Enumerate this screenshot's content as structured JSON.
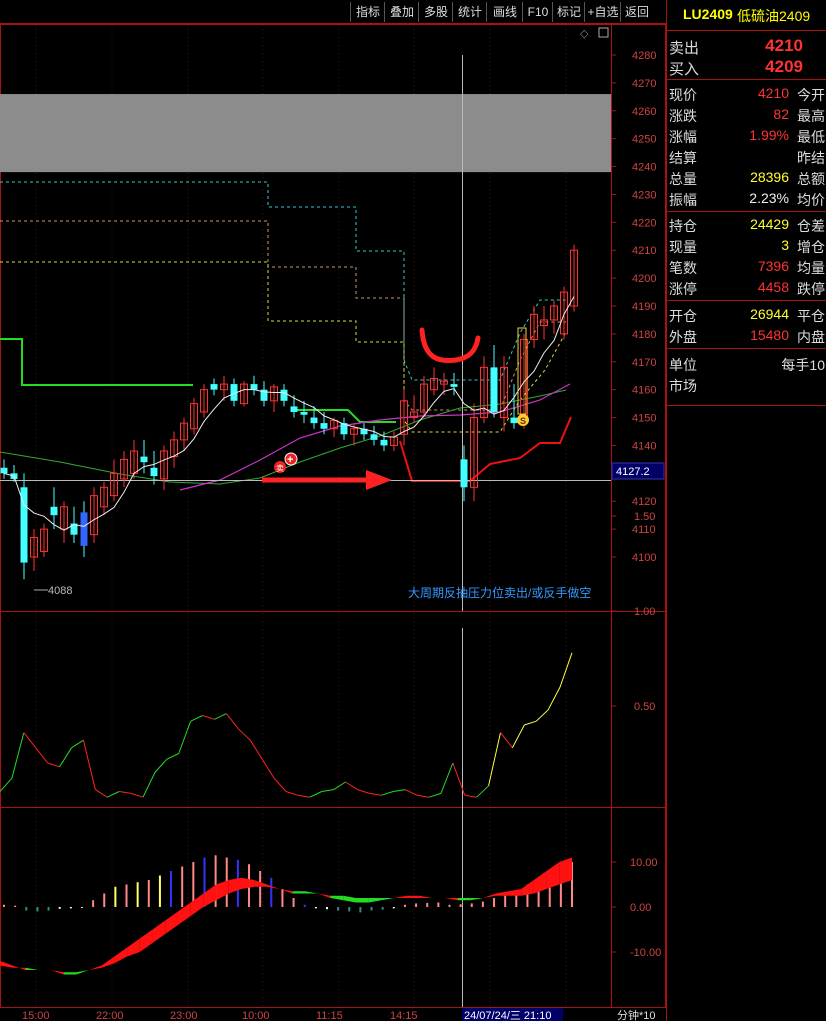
{
  "toolbar": {
    "buttons": [
      "指标",
      "叠加",
      "多股",
      "统计",
      "画线",
      "F10",
      "标记",
      "+自选",
      "返回"
    ]
  },
  "main_chart": {
    "price_ticks": [
      "4280",
      "4270",
      "4260",
      "4250",
      "4240",
      "4230",
      "4220",
      "4210",
      "4200",
      "4190",
      "4180",
      "4170",
      "4160",
      "4150",
      "4140",
      "4130",
      "4120",
      "4110",
      "4100"
    ],
    "crosshair_price": "4127.2",
    "low_marker": "4088",
    "annotation": "大周期反抽压力位卖出/或反手做空",
    "signal_badge_left": "卖",
    "signal_badge_right": "S"
  },
  "indicator1": {
    "ticks": [
      "1.50",
      "1.00",
      "0.50"
    ]
  },
  "indicator2": {
    "ticks": [
      "10.00",
      "0.00",
      "-10.00"
    ]
  },
  "time_axis": {
    "labels": [
      "15:00",
      "22:00",
      "23:00",
      "10:00",
      "11:15",
      "14:15"
    ],
    "cursor_label": "24/07/24/三  21:10",
    "period_label": "分钟*10"
  },
  "chart_data": {
    "type": "candlestick",
    "yrange": [
      4085,
      4287
    ],
    "candles_ohlc": [
      [
        4132,
        4135,
        4128,
        4130
      ],
      [
        4130,
        4133,
        4127,
        4128
      ],
      [
        4125,
        4130,
        4092,
        4098
      ],
      [
        4100,
        4110,
        4095,
        4107
      ],
      [
        4102,
        4112,
        4100,
        4110
      ],
      [
        4118,
        4125,
        4110,
        4115
      ],
      [
        4110,
        4120,
        4105,
        4118
      ],
      [
        4112,
        4118,
        4105,
        4108
      ],
      [
        4116,
        4120,
        4100,
        4104
      ],
      [
        4108,
        4125,
        4105,
        4122
      ],
      [
        4118,
        4127,
        4115,
        4125
      ],
      [
        4122,
        4135,
        4120,
        4130
      ],
      [
        4128,
        4138,
        4125,
        4135
      ],
      [
        4130,
        4142,
        4128,
        4138
      ],
      [
        4136,
        4142,
        4130,
        4134
      ],
      [
        4132,
        4138,
        4126,
        4129
      ],
      [
        4128,
        4140,
        4124,
        4138
      ],
      [
        4136,
        4145,
        4132,
        4142
      ],
      [
        4142,
        4150,
        4138,
        4148
      ],
      [
        4146,
        4157,
        4144,
        4155
      ],
      [
        4152,
        4162,
        4150,
        4160
      ],
      [
        4162,
        4164,
        4158,
        4160
      ],
      [
        4160,
        4165,
        4156,
        4162
      ],
      [
        4162,
        4164,
        4154,
        4156
      ],
      [
        4155,
        4163,
        4154,
        4162
      ],
      [
        4162,
        4165,
        4158,
        4160
      ],
      [
        4160,
        4163,
        4154,
        4156
      ],
      [
        4156,
        4162,
        4152,
        4161
      ],
      [
        4160,
        4162,
        4154,
        4156
      ],
      [
        4154,
        4158,
        4150,
        4152
      ],
      [
        4152,
        4156,
        4148,
        4151
      ],
      [
        4150,
        4154,
        4146,
        4148
      ],
      [
        4148,
        4152,
        4144,
        4146
      ],
      [
        4146,
        4150,
        4143,
        4149
      ],
      [
        4148,
        4150,
        4142,
        4144
      ],
      [
        4144,
        4148,
        4140,
        4146
      ],
      [
        4146,
        4148,
        4142,
        4144
      ],
      [
        4144,
        4147,
        4140,
        4142
      ],
      [
        4142,
        4145,
        4138,
        4140
      ],
      [
        4140,
        4145,
        4138,
        4143
      ],
      [
        4144,
        4160,
        4140,
        4156
      ],
      [
        4150,
        4158,
        4148,
        4152
      ],
      [
        4152,
        4165,
        4150,
        4162
      ],
      [
        4160,
        4168,
        4158,
        4164
      ],
      [
        4162,
        4166,
        4158,
        4163
      ],
      [
        4162,
        4166,
        4158,
        4161
      ],
      [
        4135,
        4140,
        4120,
        4125
      ],
      [
        4125,
        4155,
        4120,
        4150
      ],
      [
        4150,
        4172,
        4148,
        4168
      ],
      [
        4168,
        4176,
        4150,
        4152
      ],
      [
        4150,
        4172,
        4145,
        4168
      ],
      [
        4150,
        4162,
        4146,
        4148
      ],
      [
        4148,
        4180,
        4146,
        4178
      ],
      [
        4178,
        4190,
        4175,
        4187
      ],
      [
        4183,
        4190,
        4178,
        4185
      ],
      [
        4185,
        4192,
        4180,
        4190
      ],
      [
        4180,
        4197,
        4178,
        4195
      ],
      [
        4190,
        4212,
        4188,
        4210
      ]
    ],
    "indicator1_series": [
      0.05,
      0.12,
      0.36,
      0.28,
      0.2,
      0.18,
      0.28,
      0.32,
      0.06,
      0.02,
      0.05,
      0.04,
      0.02,
      0.15,
      0.22,
      0.25,
      0.42,
      0.45,
      0.43,
      0.46,
      0.38,
      0.32,
      0.22,
      0.12,
      0.05,
      0.03,
      0.02,
      0.05,
      0.06,
      0.1,
      0.06,
      0.04,
      0.03,
      0.05,
      0.06,
      0.03,
      0.02,
      0.04,
      0.2,
      0.03,
      0.02,
      0.08,
      0.36,
      0.28,
      0.4,
      0.42,
      0.48,
      0.6,
      0.78
    ],
    "indicator2_macd": [
      0.5,
      0.3,
      -0.8,
      -1.0,
      -0.8,
      -0.4,
      -0.3,
      -0.2,
      1.5,
      3.0,
      4.5,
      5.0,
      5.5,
      6.0,
      7.0,
      8.0,
      9.0,
      10.0,
      11.0,
      11.5,
      11.0,
      10.5,
      9.5,
      8.0,
      6.5,
      4.0,
      2.0,
      0.5,
      -0.3,
      -0.5,
      -0.8,
      -1.0,
      -1.2,
      -0.8,
      -0.6,
      -0.3,
      0.5,
      0.8,
      0.9,
      1.0,
      0.5,
      0.6,
      0.8,
      1.2,
      2.0,
      2.5,
      3.5,
      5.0,
      6.5,
      7.5,
      8.5,
      10.0
    ]
  },
  "sidebar": {
    "code": "LU2409",
    "name": "低硫油2409",
    "sell_label": "卖出",
    "sell_value": "4210",
    "buy_label": "买入",
    "buy_value": "4209",
    "rows1": [
      {
        "label": "现价",
        "value": "4210",
        "label2": "今开",
        "color": "red"
      },
      {
        "label": "涨跌",
        "value": "82",
        "label2": "最高",
        "color": "red"
      },
      {
        "label": "涨幅",
        "value": "1.99%",
        "label2": "最低",
        "color": "red"
      },
      {
        "label": "结算",
        "value": "",
        "label2": "昨结",
        "color": "wht"
      },
      {
        "label": "总量",
        "value": "28396",
        "label2": "总额",
        "color": "yel"
      },
      {
        "label": "振幅",
        "value": "2.23%",
        "label2": "均价",
        "color": "wht"
      }
    ],
    "rows2": [
      {
        "label": "持仓",
        "value": "24429",
        "label2": "仓差",
        "color": "yel"
      },
      {
        "label": "现量",
        "value": "3",
        "label2": "增仓",
        "color": "yel"
      },
      {
        "label": "笔数",
        "value": "7396",
        "label2": "均量",
        "color": "red"
      },
      {
        "label": "涨停",
        "value": "4458",
        "label2": "跌停",
        "color": "red"
      }
    ],
    "rows3": [
      {
        "label": "开仓",
        "value": "26944",
        "label2": "平仓",
        "color": "yel"
      },
      {
        "label": "外盘",
        "value": "15480",
        "label2": "内盘",
        "color": "red"
      }
    ],
    "unit_label": "单位",
    "unit_value": "每手10",
    "market_label": "市场"
  }
}
